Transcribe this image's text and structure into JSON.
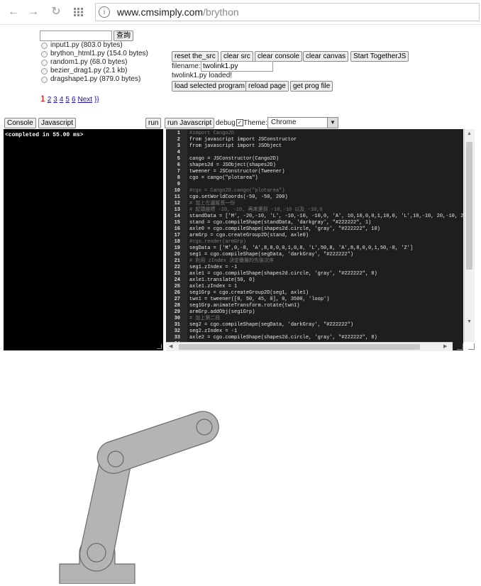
{
  "browser": {
    "url_host": "www.cmsimply.com",
    "url_path": "/brython"
  },
  "search": {
    "value": "",
    "button_label": "查詢"
  },
  "files": [
    {
      "name": "input1.py",
      "size": "(803.0 bytes)"
    },
    {
      "name": "brython_html1.py",
      "size": "(154.0 bytes)"
    },
    {
      "name": "random1.py",
      "size": "(68.0 bytes)"
    },
    {
      "name": "bezier_drag1.py",
      "size": "(2.1 kb)"
    },
    {
      "name": "dragshape1.py",
      "size": "(879.0 bytes)"
    }
  ],
  "pager": {
    "pages": [
      "1",
      "2",
      "3",
      "4",
      "5",
      "6"
    ],
    "next": "Next",
    "last": "}}"
  },
  "toolbar": {
    "reset": "reset the_src",
    "clear_src": "clear src",
    "clear_console": "clear console",
    "clear_canvas": "clear canvas",
    "together": "Start TogetherJS",
    "filename_label": "filename:",
    "filename_value": "twolink1.py",
    "status": "twolink1.py loaded!",
    "load": "load selected program",
    "reload": "reload page",
    "get_prog": "get prog file"
  },
  "bar2": {
    "console": "Console",
    "javascript": "Javascript",
    "run": "run",
    "run_js": "run Javascript",
    "debug": "debug",
    "theme_label": "Theme:",
    "theme_value": "Chrome"
  },
  "console_output": "<completed in  55.00 ms>",
  "code_lines": [
    "#import Cango2D",
    "from javascript import JSConstructor",
    "from javascript import JSObject",
    "",
    "cango = JSConstructor(Cango2D)",
    "shapes2d = JSObject(shapes2D)",
    "tweener = JSConstructor(Tweener)",
    "cgo = cango(\"plotarea\")",
    "",
    "#cgo = Cango2D.cango(\"plotarea\")",
    "cgo.setWorldCoords(-50, -50, 200)",
    "# 加上左邊縱長一份",
    "# 起頭座標 -20, -10, 再來連到 -10,-10 以及 -10,0",
    "standData = ['M', -20,-10, 'L', -10,-10, -10,0, 'A', 10,10,0,0,1,10,0, 'L',10,-10, 20,-10, 20,-40, -20,",
    "stand = cgo.compileShape(standData, 'darkgray', \"#222222\", 1)",
    "axle0 = cgo.compileShape(shapes2d.circle, 'gray', \"#222222\", 10)",
    "armGrp = cgo.createGroup2D(stand, axle0)",
    "#cgo.render(armGrp)",
    "segData = ['M',0,-8, 'A',8,8,0,0,1,0,8, 'L',50,8, 'A',8,8,0,0,1,50,-8, 'Z']",
    "seg1 = cgo.compileShape(segData, 'darkGray', \"#222222\")",
    "# 利用 zIndex 決定疊層的先後次序",
    "seg1.zIndex = -1",
    "axle1 = cgo.compileShape(shapes2d.circle, 'gray', \"#222222\", 8)",
    "axle1.translate(50, 0)",
    "axle1.zIndex = 1",
    "seg1Grp = cgo.createGroup2D(seg1, axle1)",
    "twn1 = tweener([0, 50, 45, 0], 0, 3500, 'loop')",
    "seg1Grp.animateTransform.rotate(twn1)",
    "armGrp.addObj(seg1Grp)",
    "# 加上第二段",
    "seg2 = cgo.compileShape(segData, 'darkGray', \"#222222\")",
    "seg2.zIndex = -1",
    "axle2 = cgo.compileShape(shapes2d.circle, 'gray', \"#222222\", 8)",
    ""
  ]
}
